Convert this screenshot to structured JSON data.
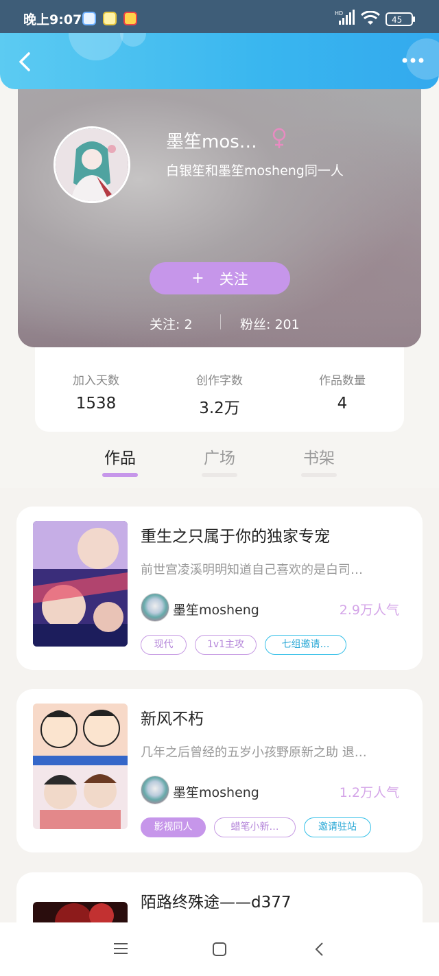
{
  "status": {
    "time": "晚上9:07",
    "battery": "45",
    "hd": "HD"
  },
  "profile": {
    "username": "墨笙mos…",
    "bio": "白银笙和墨笙mosheng同一人",
    "follow_label": "关注",
    "following_text": "关注: 2",
    "followers_text": "粉丝: 201"
  },
  "stats": [
    {
      "label": "加入天数",
      "value": "1538"
    },
    {
      "label": "创作字数",
      "value": "3.2万"
    },
    {
      "label": "作品数量",
      "value": "4"
    }
  ],
  "tabs": [
    {
      "label": "作品",
      "active": true
    },
    {
      "label": "广场",
      "active": false
    },
    {
      "label": "书架",
      "active": false
    }
  ],
  "books": [
    {
      "title": "重生之只属于你的独家专宠",
      "desc": "前世宫凌溪明明知道自己喜欢的是白司…",
      "author": "墨笙mosheng",
      "popularity": "2.9万人气",
      "tags": [
        {
          "label": "现代",
          "style": "purple"
        },
        {
          "label": "1v1主攻",
          "style": "purple"
        },
        {
          "label": "七组邀请…",
          "style": "cyan"
        }
      ]
    },
    {
      "title": "新风不朽",
      "desc": "几年之后曾经的五岁小孩野原新之助 退…",
      "author": "墨笙mosheng",
      "popularity": "1.2万人气",
      "tags": [
        {
          "label": "影视同人",
          "style": "filled"
        },
        {
          "label": "蜡笔小新…",
          "style": "purple"
        },
        {
          "label": "邀请驻站",
          "style": "cyan"
        }
      ]
    },
    {
      "title": "陌路终殊途——d377"
    }
  ],
  "colors": {
    "accent": "#c696ea",
    "header": "#39b6ef",
    "cyan_tag": "#35c0e8",
    "popularity": "#d4a5e8"
  }
}
